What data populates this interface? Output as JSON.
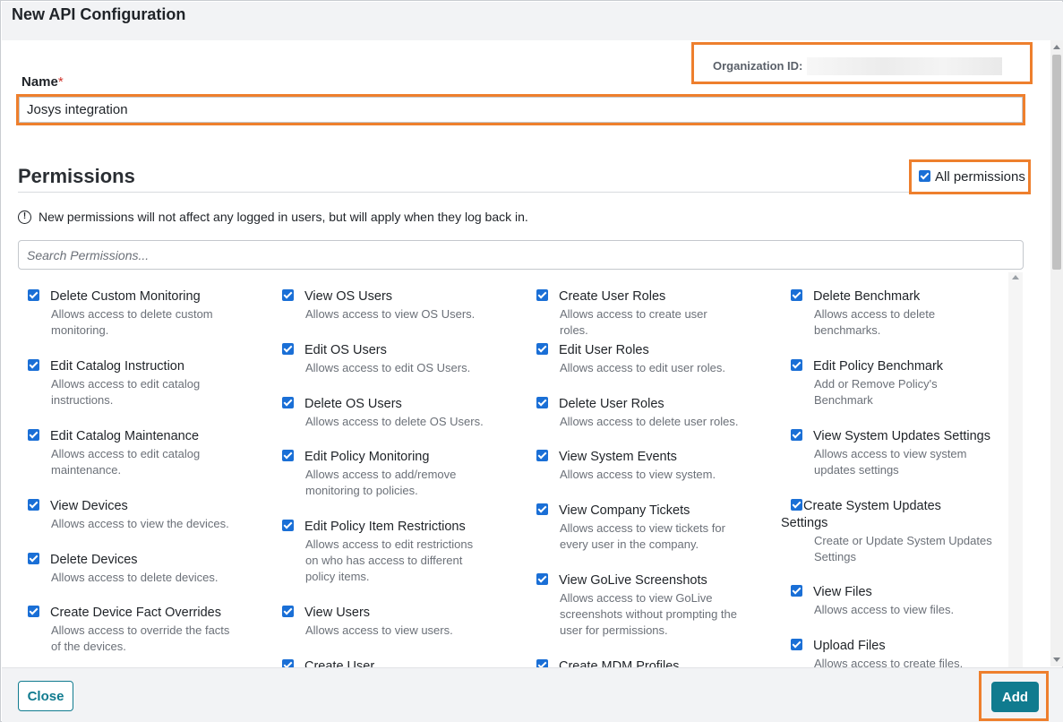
{
  "dialog": {
    "title": "New API Configuration"
  },
  "org": {
    "label": "Organization ID:",
    "value": ""
  },
  "name": {
    "label": "Name",
    "required_mark": "*",
    "value": "Josys integration"
  },
  "permissions": {
    "title": "Permissions",
    "all_label": "All permissions",
    "all_checked": true,
    "note": "New permissions will not affect any logged in users, but will apply when they log back in.",
    "search_placeholder": "Search Permissions...",
    "columns": [
      [
        {
          "name": "Delete Custom Monitoring",
          "desc": "Allows access to delete custom monitoring."
        },
        {
          "name": "Edit Catalog Instruction",
          "desc": "Allows access to edit catalog instructions."
        },
        {
          "name": "Edit Catalog Maintenance",
          "desc": "Allows access to edit catalog maintenance."
        },
        {
          "name": "View Devices",
          "desc": "Allows access to view the devices."
        },
        {
          "name": "Delete Devices",
          "desc": "Allows access to delete devices."
        },
        {
          "name": "Create Device Fact Overrides",
          "desc": "Allows access to override the facts of the devices."
        }
      ],
      [
        {
          "name": "View OS Users",
          "desc": "Allows access to view OS Users."
        },
        {
          "name": "Edit OS Users",
          "desc": "Allows access to edit OS Users."
        },
        {
          "name": "Delete OS Users",
          "desc": "Allows access to delete OS Users."
        },
        {
          "name": "Edit Policy Monitoring",
          "desc": "Allows access to add/remove monitoring to policies."
        },
        {
          "name": "Edit Policy Item Restrictions",
          "desc": "Allows access to edit restrictions on who has access to different policy items."
        },
        {
          "name": "View Users",
          "desc": "Allows access to view users."
        },
        {
          "name": "Create User",
          "desc": ""
        }
      ],
      [
        {
          "name": "Create User Roles",
          "desc": "Allows access to create user roles."
        },
        {
          "name": "Edit User Roles",
          "desc": "Allows access to edit user roles."
        },
        {
          "name": "Delete User Roles",
          "desc": "Allows access to delete user roles."
        },
        {
          "name": "View System Events",
          "desc": "Allows access to view system."
        },
        {
          "name": "View Company Tickets",
          "desc": "Allows access to view tickets for every user in the company."
        },
        {
          "name": "View GoLive Screenshots",
          "desc": "Allows access to view GoLive screenshots without prompting the user for permissions."
        },
        {
          "name": "Create MDM Profiles",
          "desc": ""
        }
      ],
      [
        {
          "name": "Delete Benchmark",
          "desc": "Allows access to delete benchmarks."
        },
        {
          "name": "Edit Policy Benchmark",
          "desc": "Add or Remove Policy's Benchmark"
        },
        {
          "name": "View System Updates Settings",
          "desc": "Allows access to view system updates settings"
        },
        {
          "name": "Create System Updates Settings",
          "desc": "Create or Update System Updates Settings"
        },
        {
          "name": "View Files",
          "desc": "Allows access to view files."
        },
        {
          "name": "Upload Files",
          "desc": "Allows access to create files."
        }
      ]
    ]
  },
  "footer": {
    "close_label": "Close",
    "add_label": "Add"
  },
  "colors": {
    "accent": "#107b8f",
    "highlight": "#ee7f2d",
    "checkbox": "#1a6fd6"
  }
}
